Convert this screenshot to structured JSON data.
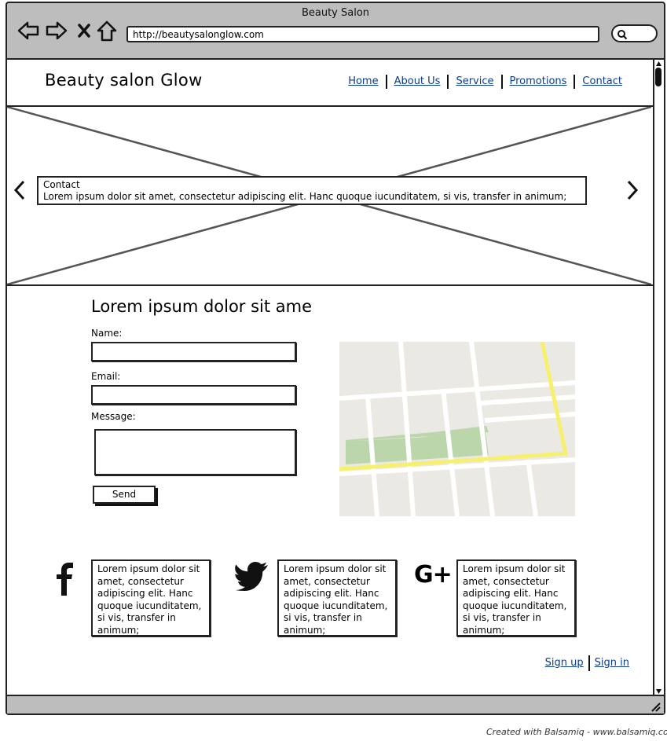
{
  "window": {
    "title": "Beauty Salon",
    "url": "http://beautysalonglow.com"
  },
  "header": {
    "site_title": "Beauty salon Glow",
    "nav": [
      "Home",
      "About Us",
      "Service",
      "Promotions",
      "Contact"
    ]
  },
  "hero": {
    "caption_title": "Contact",
    "caption_text": "Lorem ipsum dolor sit amet, consectetur adipiscing elit. Hanc quoque iucunditatem, si vis, transfer in animum;"
  },
  "contact": {
    "heading": "Lorem ipsum dolor sit ame",
    "name_label": "Name:",
    "email_label": "Email:",
    "message_label": "Message:",
    "send_label": "Send"
  },
  "social": [
    {
      "icon": "facebook-icon",
      "text": "Lorem ipsum dolor sit amet, consectetur adipiscing elit. Hanc quoque iucunditatem, si vis, transfer in animum;"
    },
    {
      "icon": "twitter-icon",
      "text": "Lorem ipsum dolor sit amet, consectetur adipiscing elit. Hanc quoque iucunditatem, si vis, transfer in animum;"
    },
    {
      "icon": "google-plus-icon",
      "text": "Lorem ipsum dolor sit amet, consectetur adipiscing elit. Hanc quoque iucunditatem, si vis, transfer in animum;"
    }
  ],
  "google_plus_glyph": "G+",
  "auth": {
    "sign_up": "Sign up",
    "sign_in": "Sign in"
  },
  "watermark": "Created with Balsamiq - www.balsamiq.co",
  "colors": {
    "link": "#0a3d91",
    "frame": "#bdbdbd",
    "map_road_highlight": "#f7f06e",
    "map_park": "#bcd6ac"
  }
}
